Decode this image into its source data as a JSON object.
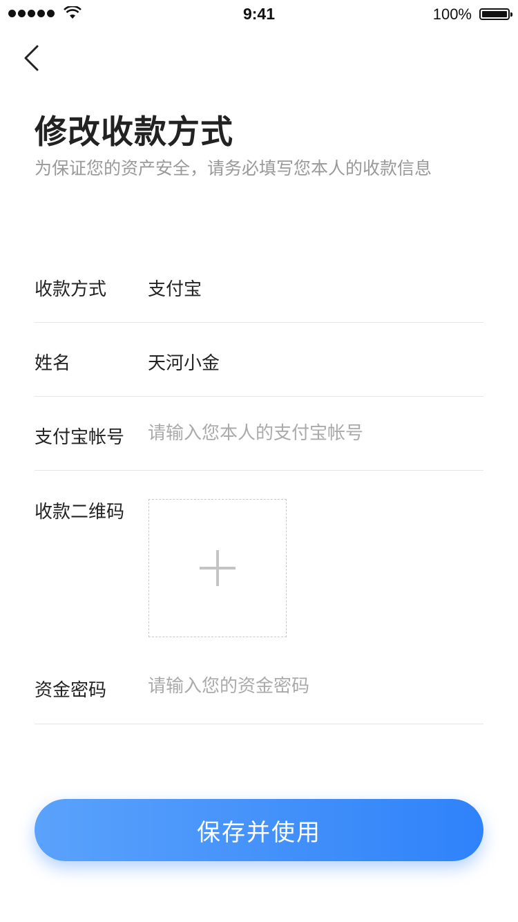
{
  "status_bar": {
    "time": "9:41",
    "battery_percent": "100%",
    "icons": [
      "signal-icon",
      "wifi-icon",
      "battery-icon"
    ]
  },
  "header": {
    "back_icon": "chevron-left-icon",
    "title": "修改收款方式",
    "subtitle": "为保证您的资产安全，请务必填写您本人的收款信息"
  },
  "form": {
    "payment_method": {
      "label": "收款方式",
      "value": "支付宝"
    },
    "name": {
      "label": "姓名",
      "value": "天河小金"
    },
    "alipay_account": {
      "label": "支付宝帐号",
      "placeholder": "请输入您本人的支付宝帐号",
      "value": ""
    },
    "qr_code": {
      "label": "收款二维码",
      "icon": "plus-icon"
    },
    "fund_password": {
      "label": "资金密码",
      "placeholder": "请输入您的资金密码",
      "value": ""
    }
  },
  "actions": {
    "save_label": "保存并使用"
  },
  "colors": {
    "accent_start": "#5aa2fb",
    "accent_end": "#2f82fa",
    "title_text": "#222222",
    "subtitle_text": "#999999",
    "placeholder_text": "#aaaaaa",
    "divider": "#e6e6e6"
  }
}
